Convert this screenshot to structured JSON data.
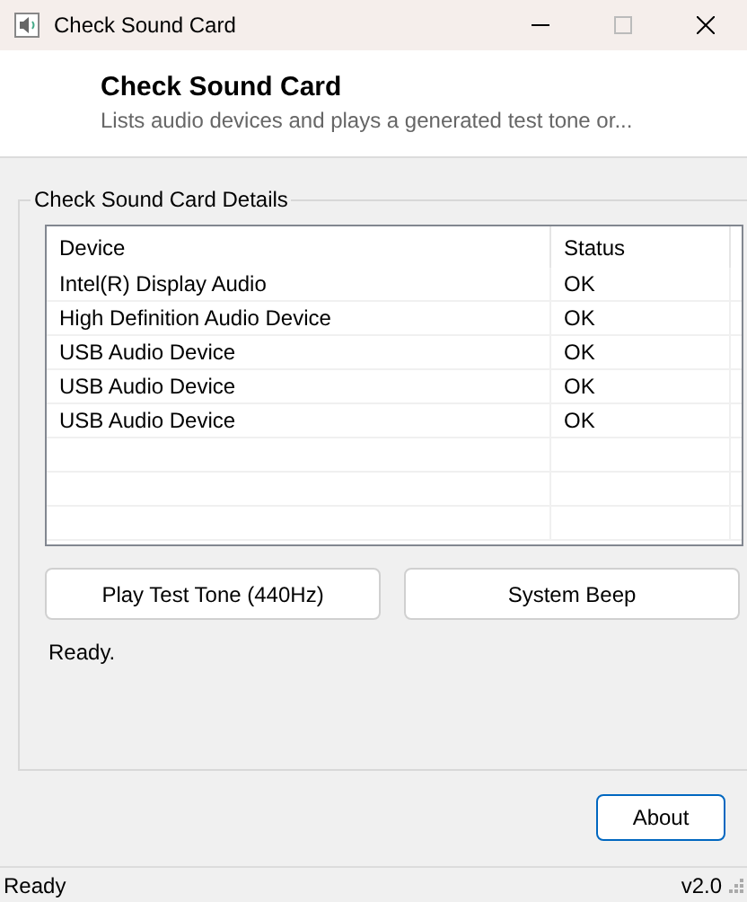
{
  "window": {
    "title": "Check Sound Card"
  },
  "header": {
    "title": "Check Sound Card",
    "subtitle": "Lists audio devices and plays a generated test tone or..."
  },
  "group": {
    "title": "Check Sound Card Details"
  },
  "table": {
    "columns": [
      "Device",
      "Status"
    ],
    "rows": [
      [
        "Intel(R) Display Audio",
        "OK"
      ],
      [
        "High Definition Audio Device",
        "OK"
      ],
      [
        "USB Audio Device",
        "OK"
      ],
      [
        "USB Audio Device",
        "OK"
      ],
      [
        "USB Audio Device",
        "OK"
      ]
    ]
  },
  "buttons": [
    "Play Test Tone (440Hz)",
    "System Beep"
  ],
  "message": "Ready.",
  "about_button": "About",
  "status_bar": {
    "left": "Ready",
    "right": "v2.0"
  }
}
